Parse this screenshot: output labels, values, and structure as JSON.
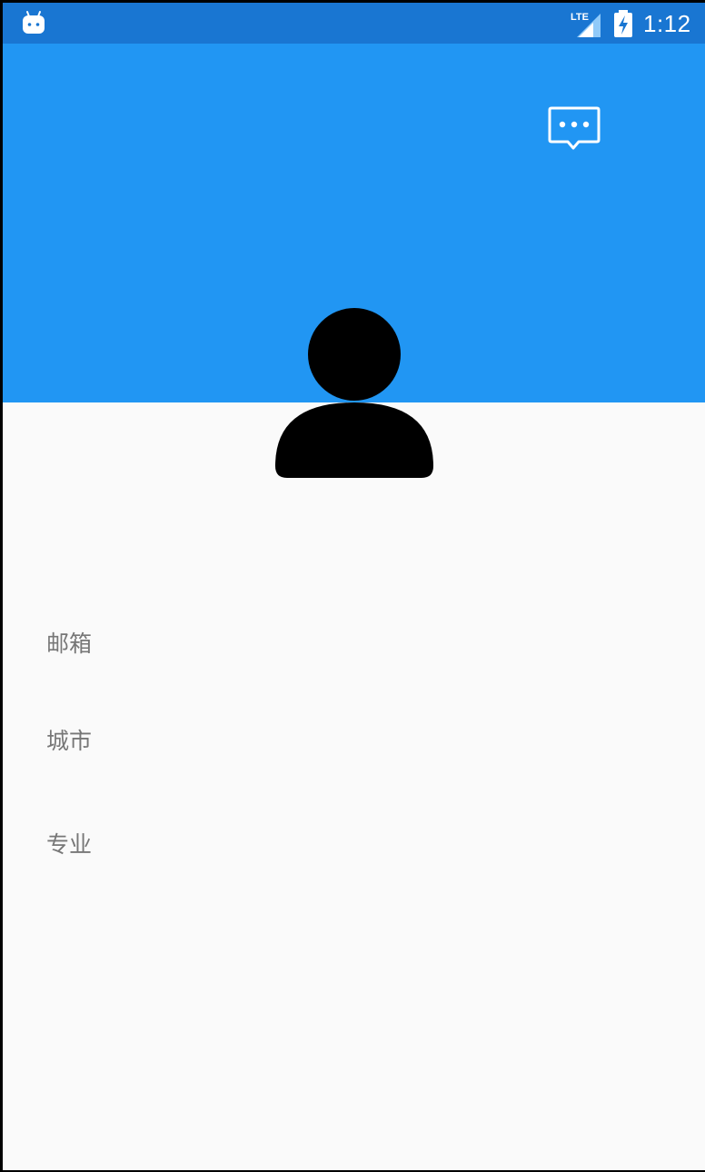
{
  "status_bar": {
    "app_icon": "android-icon",
    "network_label": "LTE",
    "network_icon": "lte-signal-icon",
    "battery_icon": "battery-charging-icon",
    "time": "1:12",
    "color": "#1976D2"
  },
  "header": {
    "color": "#2196F3",
    "action_icon": "message-icon"
  },
  "profile": {
    "avatar_icon": "person-icon",
    "fields": {
      "email_label": "邮箱",
      "city_label": "城市",
      "major_label": "专业"
    }
  }
}
